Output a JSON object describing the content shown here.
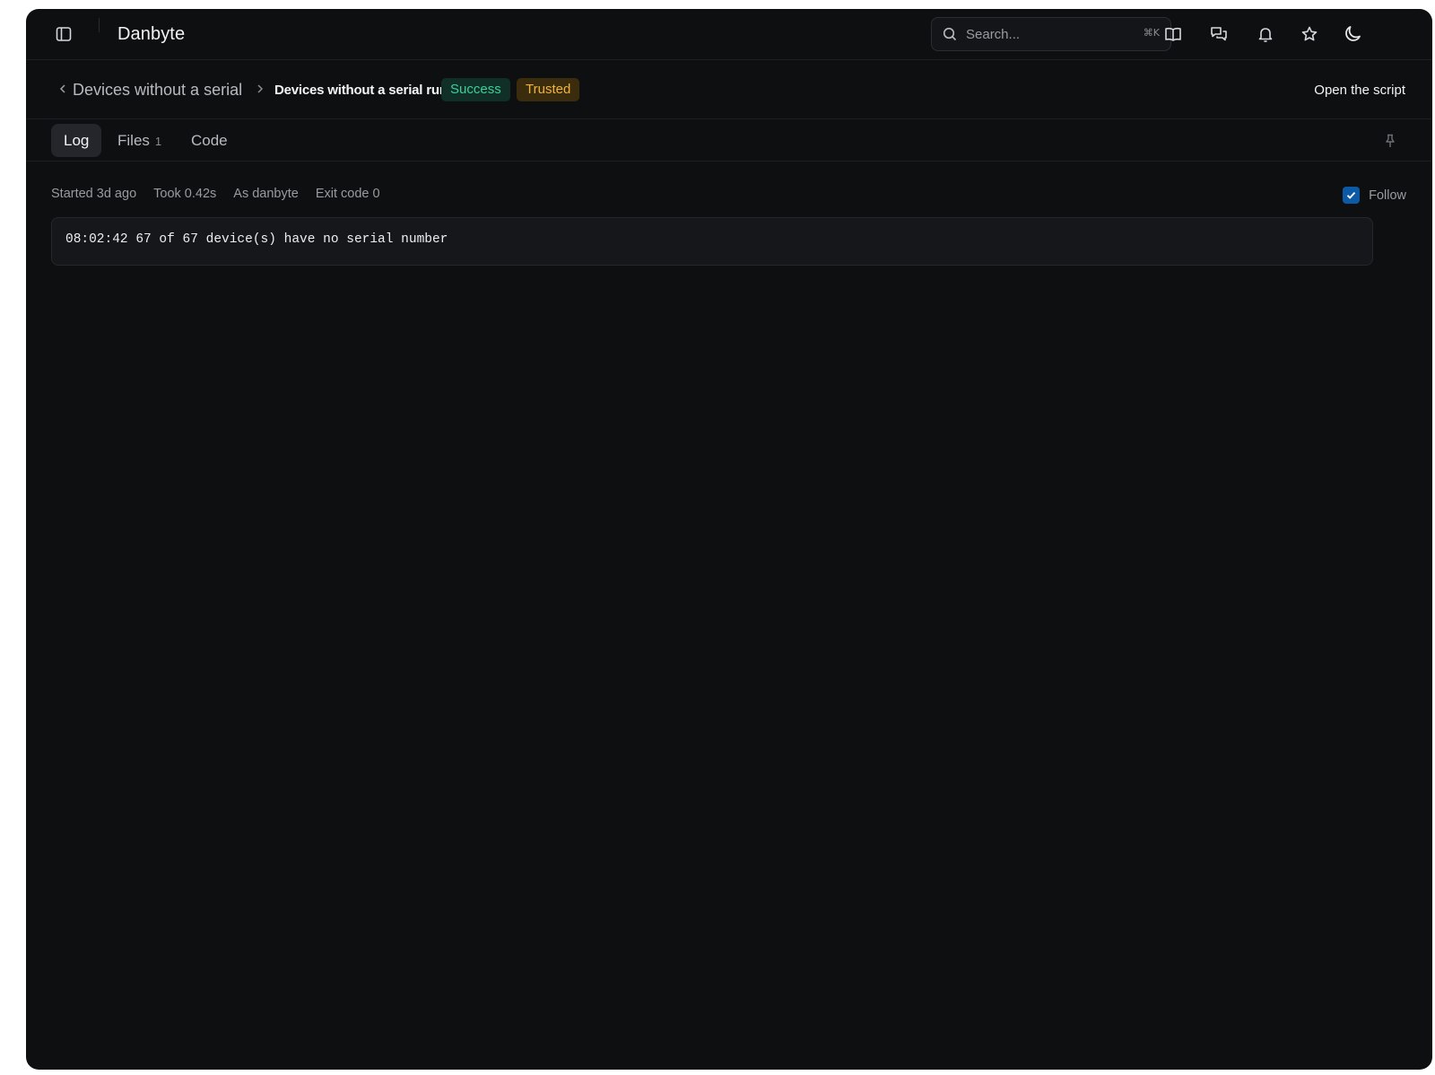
{
  "app": {
    "title": "Danbyte"
  },
  "search": {
    "placeholder": "Search...",
    "shortcut": "⌘K"
  },
  "header_icons": [
    "book-open-icon",
    "chat-icon",
    "bell-icon",
    "star-icon",
    "moon-icon"
  ],
  "breadcrumb": {
    "parent": "Devices without a serial",
    "current": "Devices without a serial run",
    "badges": [
      {
        "label": "Success",
        "color": "#3ecf9a"
      },
      {
        "label": "Trusted",
        "color": "#f0b43c"
      }
    ],
    "action": "Open the script"
  },
  "tabs": [
    {
      "label": "Log",
      "active": true
    },
    {
      "label": "Files",
      "count": "1"
    },
    {
      "label": "Code"
    }
  ],
  "meta": {
    "started": "Started 3d ago",
    "took": "Took 0.42s",
    "as_user": "As danbyte",
    "exit_code": "Exit code 0"
  },
  "follow": {
    "label": "Follow",
    "checked": true
  },
  "log": {
    "lines": [
      "08:02:42 67 of 67 device(s) have no serial number"
    ]
  },
  "colors": {
    "accent": "#0c5aa6",
    "background": "#0e0f11"
  }
}
